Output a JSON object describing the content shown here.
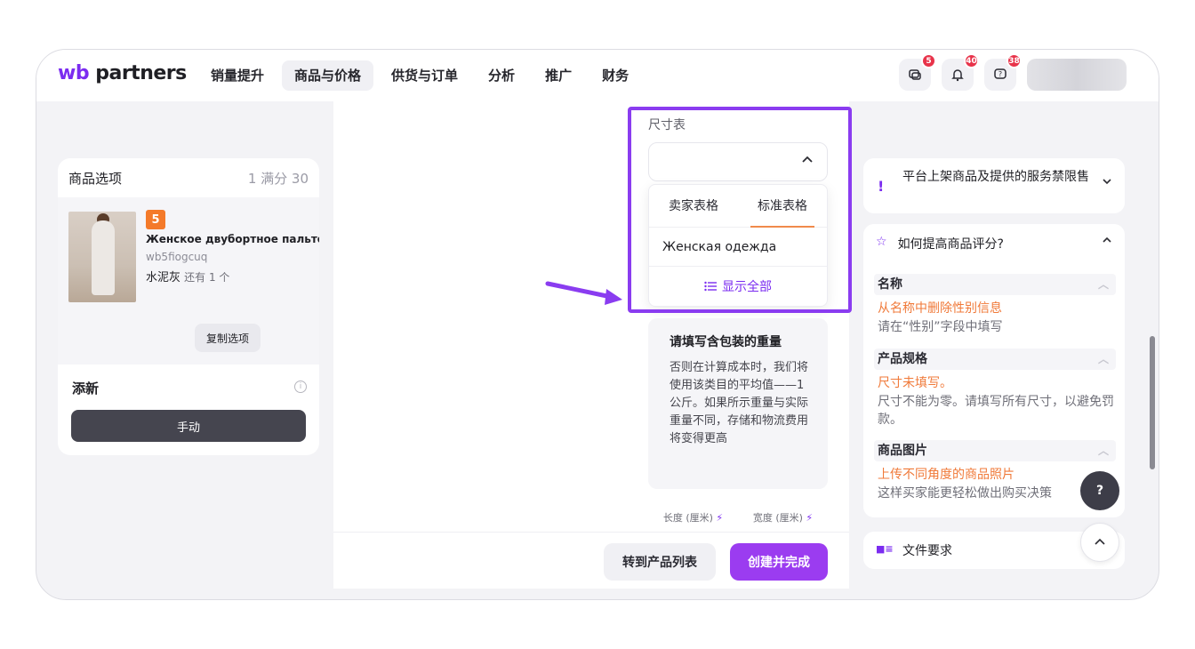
{
  "app": {
    "logo_brand": "wb",
    "logo_rest": " partners"
  },
  "nav": {
    "items": [
      "销量提升",
      "商品与价格",
      "供货与订单",
      "分析",
      "推广",
      "财务"
    ],
    "active_index": 1
  },
  "top_icons": [
    {
      "icon": "chat-icon",
      "glyph": "⌗",
      "badge": "5"
    },
    {
      "icon": "bell-icon",
      "glyph": "♪",
      "badge": "40"
    },
    {
      "icon": "help-chat-icon",
      "glyph": "?",
      "badge": "38"
    }
  ],
  "left": {
    "title": "商品选项",
    "count": "1 满分 30",
    "variant_number": "5",
    "product_name": "Женское двубортное пальто...",
    "sku": "wb5fiogcuq",
    "color": "水泥灰",
    "stock": "还有 1 个",
    "copy_button": "复制选项",
    "add_label": "添新",
    "info_glyph": "i",
    "manual_button": "手动"
  },
  "size_table": {
    "label": "尺寸表",
    "tab_seller": "卖家表格",
    "tab_standard": "标准表格",
    "option": "Женская одежда",
    "show_all": "显示全部"
  },
  "weight": {
    "title": "请填写含包装的重量",
    "text": "否则在计算成本时，我们将使用该类目的平均值——1公斤。如果所示重量与实际重量不同，存储和物流费用将变得更高"
  },
  "dims": {
    "length": "长度 (厘米)",
    "width": "宽度 (厘米)"
  },
  "bottom": {
    "goto_list": "转到产品列表",
    "create_finish": "创建并完成"
  },
  "right": {
    "banned_title": "平台上架商品及提供的服务禁限售",
    "rating_title": "如何提高商品评分?",
    "sections": [
      {
        "head": "名称",
        "warn": "从名称中删除性别信息",
        "note": "请在“性别”字段中填写"
      },
      {
        "head": "产品规格",
        "warn": "尺寸未填写。",
        "note": "尺寸不能为零。请填写所有尺寸，以避免罚款。"
      },
      {
        "head": "商品图片",
        "warn": "上传不同角度的商品照片",
        "note": "这样买家能更轻松做出购买决策"
      }
    ],
    "file_req": "文件要求"
  },
  "help_button": "?",
  "colors": {
    "accent": "#7b2cf0",
    "highlight": "#8a3cf0",
    "warning": "#f07a3a",
    "badge": "#e8334a"
  }
}
